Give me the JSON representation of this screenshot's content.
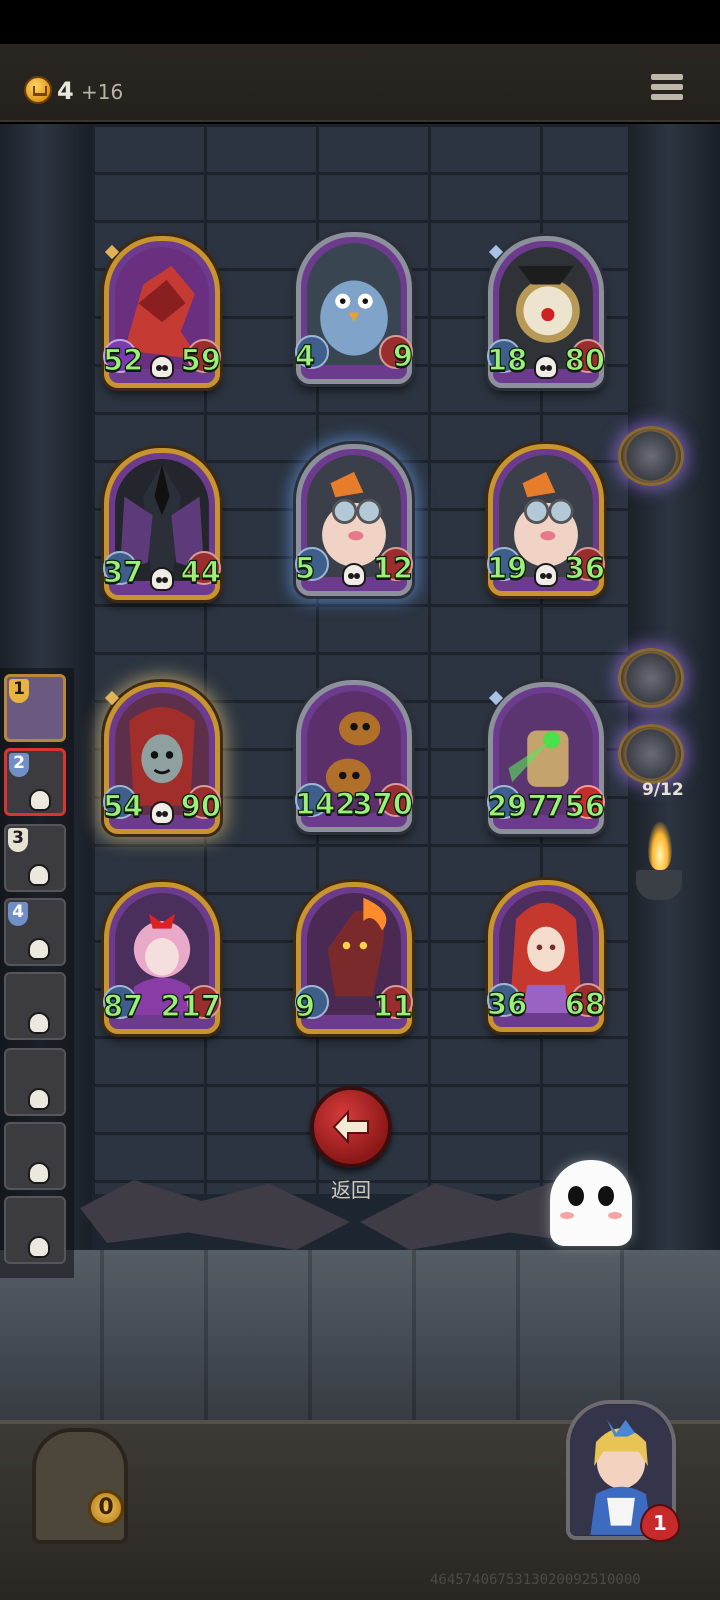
{
  "topbar": {
    "coins": "4",
    "coin_bonus": "+16",
    "coin_icon": "crown-coin-icon",
    "menu_icon": "menu-icon"
  },
  "board": {
    "cards": [
      {
        "atk": "52",
        "hp": "59",
        "frame": "gold",
        "art": "red-dragon"
      },
      {
        "atk": "4",
        "hp": "9",
        "frame": "silver",
        "art": "penguin-robot"
      },
      {
        "atk": "18",
        "hp": "80",
        "frame": "silver",
        "art": "clock-knight"
      },
      {
        "atk": "37",
        "hp": "44",
        "frame": "gold",
        "art": "dark-lord"
      },
      {
        "atk": "5",
        "hp": "12",
        "frame": "silver",
        "art": "goggle-pig"
      },
      {
        "atk": "19",
        "hp": "36",
        "frame": "gold",
        "art": "goggle-pig"
      },
      {
        "atk": "54",
        "hp": "90",
        "frame": "gold",
        "art": "zombie-girl"
      },
      {
        "atk": "142",
        "hp": "370",
        "frame": "silver",
        "art": "pumpkin-heads"
      },
      {
        "atk": "297",
        "hp": "756",
        "frame": "silver",
        "art": "laser-golem"
      },
      {
        "atk": "87",
        "hp": "217",
        "frame": "gold",
        "art": "pink-bunny"
      },
      {
        "atk": "9",
        "hp": "11",
        "frame": "gold",
        "art": "fire-demon"
      },
      {
        "atk": "36",
        "hp": "68",
        "frame": "gold",
        "art": "red-haired-elf"
      }
    ]
  },
  "rail": {
    "slots": [
      {
        "badge": "1",
        "state": "current"
      },
      {
        "badge": "2",
        "state": "selected"
      },
      {
        "badge": "3",
        "state": "normal"
      },
      {
        "badge": "4",
        "state": "normal"
      },
      {
        "badge": "",
        "state": "normal"
      },
      {
        "badge": "",
        "state": "normal"
      },
      {
        "badge": "",
        "state": "normal"
      },
      {
        "badge": "",
        "state": "normal"
      }
    ]
  },
  "watches": {
    "count_label": "9/12"
  },
  "back": {
    "label": "返回"
  },
  "chest": {
    "count": "0"
  },
  "hero": {
    "lives": "1"
  },
  "footer": {
    "id_text": "4645740675313020092510000"
  },
  "colors": {
    "stat_text": "#9cf07a",
    "gold_frame": "#c8942e",
    "silver_frame": "#8c8f9c",
    "back_button": "#c32a2a"
  }
}
